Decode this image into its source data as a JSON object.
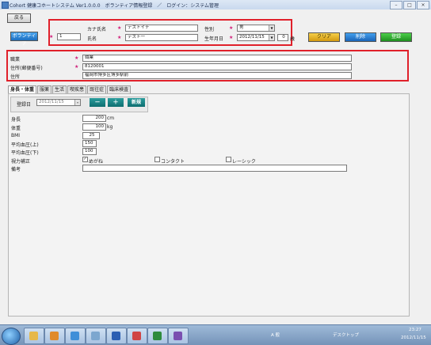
{
  "window": {
    "title": "Cohort 健康コホートシステム Ver1.0.0.0　ボランティア情報登録　／　ログイン：システム管理",
    "controls": [
      "–",
      "□",
      "×"
    ]
  },
  "toolbar": {
    "back_label": "戻る",
    "volunteer_label": "ボランティア",
    "clear_label": "クリア",
    "delete_label": "削除",
    "register_label": "登録"
  },
  "header_form": {
    "id_value": "1",
    "kana_label": "カナ氏名",
    "kana_value": "テストイチ",
    "name_label": "氏名",
    "name_value": "テスト一",
    "gender_label": "性別",
    "gender_value": "男",
    "birth_label": "生年月日",
    "birth_value": "2012/11/15",
    "age_value": "0",
    "age_unit": "歳"
  },
  "address_form": {
    "job_label": "職業",
    "job_value": "職業",
    "zip_label": "住所(郵便番号)",
    "zip_value": "8120001",
    "addr_label": "住所",
    "addr_value": "福岡市博多区博多駅前"
  },
  "tabs": [
    "身長・体重",
    "服薬",
    "生活",
    "喫疾患",
    "既往症",
    "臨床検査"
  ],
  "measure": {
    "date_label": "登録日",
    "date_value": "2012/11/15",
    "minus_label": "－",
    "plus_label": "＋",
    "new_label": "新規",
    "rows": [
      {
        "label": "身長",
        "value": "200",
        "unit": "cm"
      },
      {
        "label": "体重",
        "value": "100",
        "unit": "kg"
      },
      {
        "label": "BMI",
        "value": "25",
        "unit": ""
      },
      {
        "label": "平均血圧(上)",
        "value": "150",
        "unit": ""
      },
      {
        "label": "平均血圧(下)",
        "value": "100",
        "unit": ""
      }
    ],
    "vision_label": "視力補正",
    "vision_options": [
      {
        "label": "めがね",
        "checked": true
      },
      {
        "label": "コンタクト",
        "checked": false
      },
      {
        "label": "レーシック",
        "checked": false
      }
    ],
    "remarks_label": "備考",
    "remarks_value": ""
  },
  "taskbar": {
    "lang_label": "A 般",
    "desktop_label": "デスクトップ",
    "time": "23:27",
    "date": "2012/11/15"
  }
}
